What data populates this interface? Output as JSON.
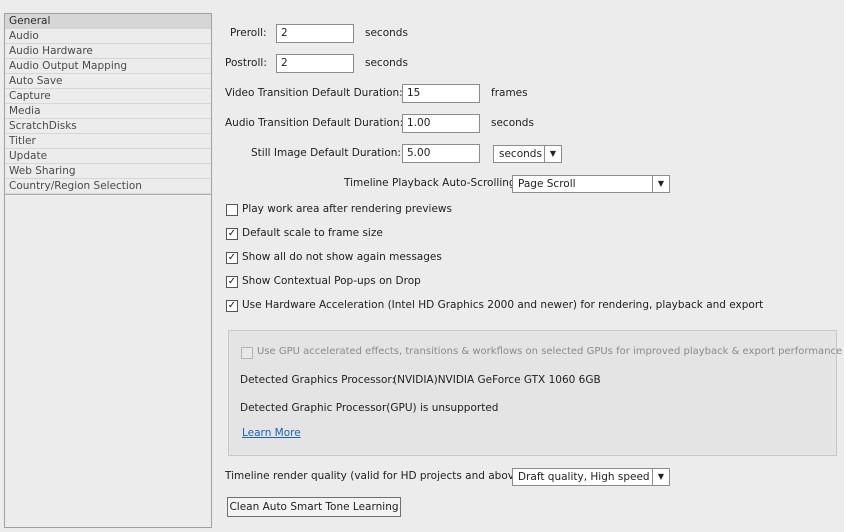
{
  "sidebar": {
    "items": [
      {
        "label": "General",
        "selected": true
      },
      {
        "label": "Audio"
      },
      {
        "label": "Audio Hardware"
      },
      {
        "label": "Audio Output Mapping"
      },
      {
        "label": "Auto Save"
      },
      {
        "label": "Capture"
      },
      {
        "label": "Media"
      },
      {
        "label": "ScratchDisks"
      },
      {
        "label": "Titler"
      },
      {
        "label": "Update"
      },
      {
        "label": "Web Sharing"
      },
      {
        "label": "Country/Region Selection"
      }
    ]
  },
  "general": {
    "preroll": {
      "label": "Preroll:",
      "value": "2",
      "unit": "seconds"
    },
    "postroll": {
      "label": "Postroll:",
      "value": "2",
      "unit": "seconds"
    },
    "video_transition": {
      "label": "Video Transition Default Duration:",
      "value": "15",
      "unit": "frames"
    },
    "audio_transition": {
      "label": "Audio Transition Default Duration:",
      "value": "1.00",
      "unit": "seconds"
    },
    "still_image": {
      "label": "Still Image Default Duration:",
      "value": "5.00",
      "unit_selected": "seconds"
    },
    "timeline_autoscroll": {
      "label": "Timeline Playback Auto-Scrolling:",
      "selected": "Page Scroll"
    },
    "checkboxes": {
      "play_work_area": {
        "label": "Play work area after rendering previews",
        "checked": false
      },
      "default_scale": {
        "label": "Default scale to frame size",
        "checked": true
      },
      "show_all_dialogs": {
        "label": "Show all do not show again messages",
        "checked": true
      },
      "contextual_popups": {
        "label": "Show Contextual Pop-ups on Drop",
        "checked": true
      },
      "hardware_accel": {
        "label": "Use Hardware Acceleration (Intel HD Graphics 2000 and newer) for rendering, playback and export",
        "checked": true
      }
    },
    "gpu": {
      "use_gpu_label": "Use GPU accelerated effects, transitions & workflows on selected GPUs for improved playback & export performance",
      "use_gpu_checked": false,
      "detected_label": "Detected Graphics Processor:",
      "detected_value": "(NVIDIA)NVIDIA GeForce GTX 1060 6GB",
      "unsupported_text": "Detected Graphic Processor(GPU) is unsupported",
      "learn_more": "Learn More"
    },
    "render_quality": {
      "label": "Timeline render quality (valid for HD projects and above):",
      "selected": "Draft quality, High speed"
    },
    "clean_button": "Clean Auto Smart Tone Learning"
  }
}
